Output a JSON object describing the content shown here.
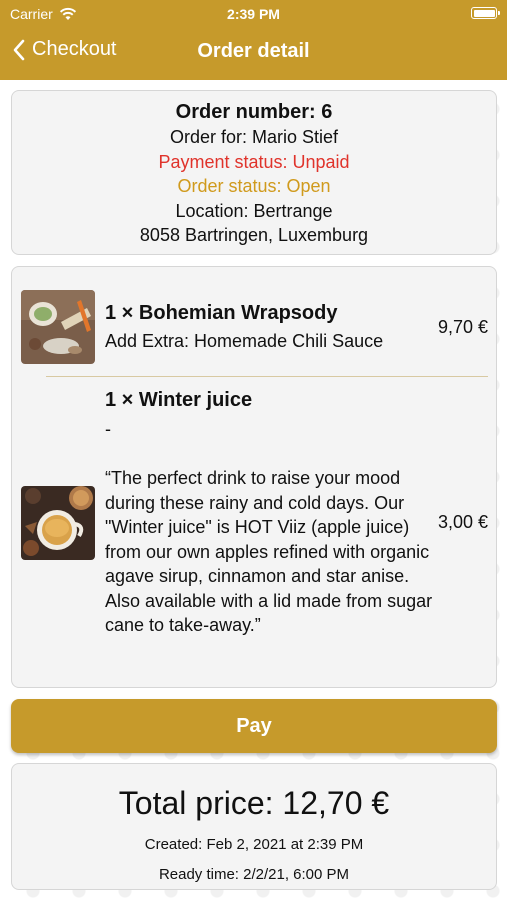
{
  "status_bar": {
    "carrier": "Carrier",
    "time": "2:39 PM"
  },
  "nav": {
    "back_label": "Checkout",
    "title": "Order detail"
  },
  "order": {
    "number": "Order number: 6",
    "order_for": "Order for: Mario Stief",
    "payment_status": "Payment status: Unpaid",
    "order_status": "Order status: Open",
    "location": "Location: Bertrange",
    "address": "8058 Bartringen, Luxemburg"
  },
  "items": [
    {
      "title": "1 × Bohemian Wrapsody",
      "description": "Add Extra: Homemade Chili Sauce",
      "price": "9,70 €",
      "thumb_icon": "wrap-food-photo"
    },
    {
      "title": "1 × Winter juice",
      "description": "-\n\n“The perfect drink to raise your mood during these rainy and cold days. Our \"Winter juice\" is HOT Viiz (apple juice) from our own apples refined with organic agave sirup, cinnamon and star anise.\nAlso available with a lid made from sugar cane to take-away.”",
      "price": "3,00 €",
      "thumb_icon": "juice-drink-photo"
    }
  ],
  "pay_button": "Pay",
  "summary": {
    "total": "Total price: 12,70 €",
    "created": "Created: Feb 2, 2021 at 2:39 PM",
    "ready": "Ready time: 2/2/21, 6:00 PM"
  },
  "colors": {
    "accent": "#c69a2b",
    "unpaid": "#e0332b",
    "open": "#d09a1c"
  }
}
